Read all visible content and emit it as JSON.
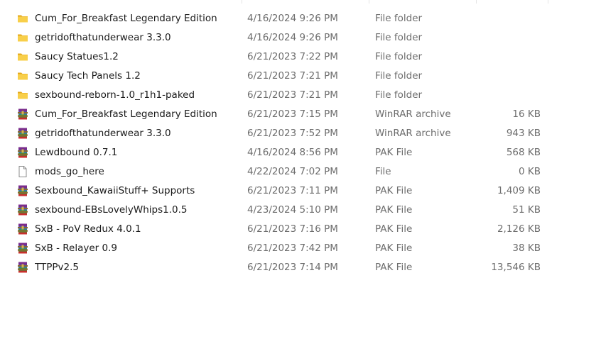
{
  "files": [
    {
      "name": "Cum_For_Breakfast Legendary Edition",
      "date": "4/16/2024 9:26 PM",
      "type": "File folder",
      "size": "",
      "icon": "folder-icon"
    },
    {
      "name": "getridofthatunderwear 3.3.0",
      "date": "4/16/2024 9:26 PM",
      "type": "File folder",
      "size": "",
      "icon": "folder-icon"
    },
    {
      "name": "Saucy Statues1.2",
      "date": "6/21/2023 7:22 PM",
      "type": "File folder",
      "size": "",
      "icon": "folder-icon"
    },
    {
      "name": "Saucy Tech Panels 1.2",
      "date": "6/21/2023 7:21 PM",
      "type": "File folder",
      "size": "",
      "icon": "folder-icon"
    },
    {
      "name": "sexbound-reborn-1.0_r1h1-paked",
      "date": "6/21/2023 7:21 PM",
      "type": "File folder",
      "size": "",
      "icon": "folder-icon"
    },
    {
      "name": "Cum_For_Breakfast Legendary Edition",
      "date": "6/21/2023 7:15 PM",
      "type": "WinRAR archive",
      "size": "16 KB",
      "icon": "winrar-icon"
    },
    {
      "name": "getridofthatunderwear 3.3.0",
      "date": "6/21/2023 7:52 PM",
      "type": "WinRAR archive",
      "size": "943 KB",
      "icon": "winrar-icon"
    },
    {
      "name": "Lewdbound 0.7.1",
      "date": "4/16/2024 8:56 PM",
      "type": "PAK File",
      "size": "568 KB",
      "icon": "winrar-icon"
    },
    {
      "name": "mods_go_here",
      "date": "4/22/2024 7:02 PM",
      "type": "File",
      "size": "0 KB",
      "icon": "blank-file-icon"
    },
    {
      "name": "Sexbound_KawaiiStuff+ Supports",
      "date": "6/21/2023 7:11 PM",
      "type": "PAK File",
      "size": "1,409 KB",
      "icon": "winrar-icon"
    },
    {
      "name": "sexbound-EBsLovelyWhips1.0.5",
      "date": "4/23/2024 5:10 PM",
      "type": "PAK File",
      "size": "51 KB",
      "icon": "winrar-icon"
    },
    {
      "name": "SxB - PoV Redux 4.0.1",
      "date": "6/21/2023 7:16 PM",
      "type": "PAK File",
      "size": "2,126 KB",
      "icon": "winrar-icon"
    },
    {
      "name": "SxB - Relayer 0.9",
      "date": "6/21/2023 7:42 PM",
      "type": "PAK File",
      "size": "38 KB",
      "icon": "winrar-icon"
    },
    {
      "name": "TTPPv2.5",
      "date": "6/21/2023 7:14 PM",
      "type": "PAK File",
      "size": "13,546 KB",
      "icon": "winrar-icon"
    }
  ],
  "colors": {
    "folder": "#f4c542",
    "folder_dark": "#e3a81d",
    "secondary_text": "#6d6d6d"
  }
}
